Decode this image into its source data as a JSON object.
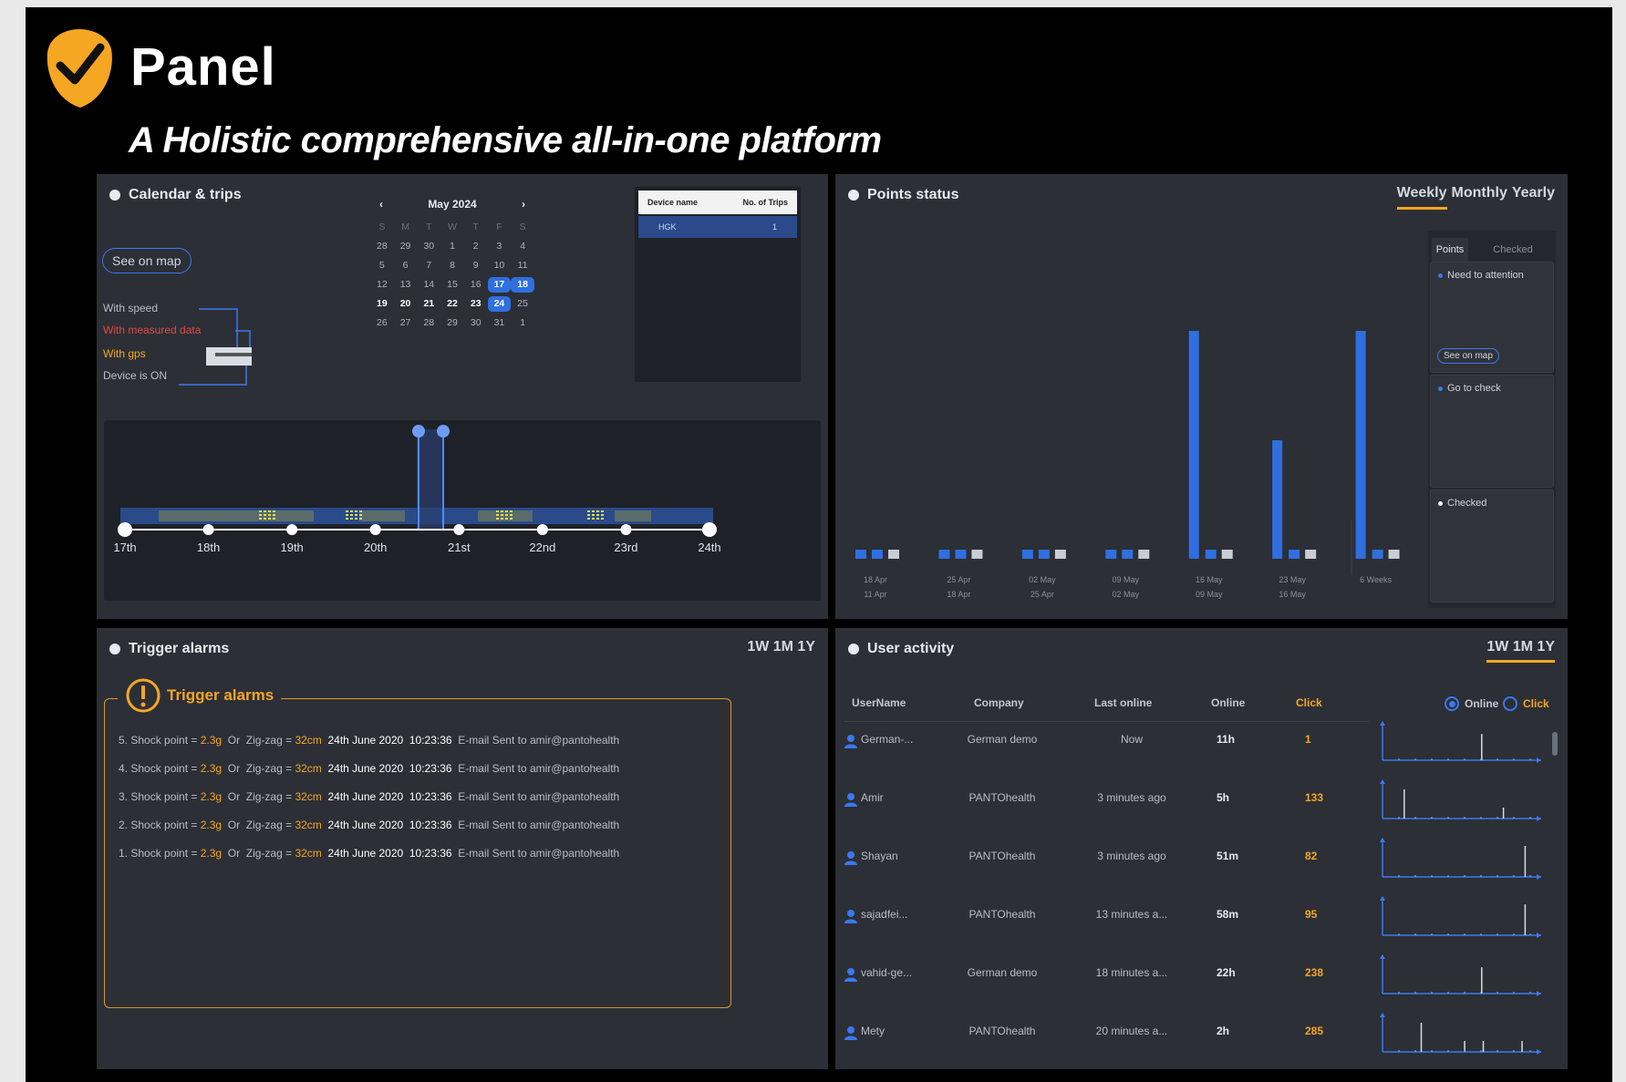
{
  "brand": {
    "name": "Panel",
    "tagline": "A Holistic comprehensive all-in-one platform"
  },
  "colors": {
    "accent_blue": "#3b78f0",
    "accent_orange": "#f5a623",
    "panel_bg": "#2c2f36"
  },
  "calendar_panel": {
    "title": "Calendar & trips",
    "see_on_map": "See on map",
    "month_label": "May 2024",
    "weekdays": [
      "S",
      "M",
      "T",
      "W",
      "T",
      "F",
      "S"
    ],
    "weeks": [
      [
        "28",
        "29",
        "30",
        "1",
        "2",
        "3",
        "4"
      ],
      [
        "5",
        "6",
        "7",
        "8",
        "9",
        "10",
        "11"
      ],
      [
        "12",
        "13",
        "14",
        "15",
        "16",
        "17",
        "18"
      ],
      [
        "19",
        "20",
        "21",
        "22",
        "23",
        "24",
        "25"
      ],
      [
        "26",
        "27",
        "28",
        "29",
        "30",
        "31",
        "1"
      ]
    ],
    "legend": {
      "speed": "With speed",
      "measured": "With measured data",
      "gps": "With gps",
      "device": "Device is ON"
    },
    "device_table": {
      "col_name": "Device name",
      "col_trips": "No. of Trips",
      "rows": [
        {
          "name": "HGK",
          "trips": "1"
        }
      ]
    },
    "timeline_days": [
      "17th",
      "18th",
      "19th",
      "20th",
      "21st",
      "22nd",
      "23rd",
      "24th"
    ]
  },
  "points_panel": {
    "title": "Points status",
    "periods": [
      "Weekly",
      "Monthly",
      "Yearly"
    ],
    "active_period": "Weekly",
    "side_tabs": [
      "Points",
      "Checked"
    ],
    "cards": {
      "attention": "Need to attention",
      "see_on_map": "See on map",
      "go_check": "Go to check",
      "checked": "Checked"
    },
    "x_labels_top": [
      "18 Apr",
      "25 Apr",
      "02 May",
      "09 May",
      "16 May",
      "23 May",
      "6 Weeks"
    ],
    "x_labels_bottom": [
      "11 Apr",
      "18 Apr",
      "25 Apr",
      "02 May",
      "09 May",
      "16 May",
      ""
    ]
  },
  "chart_data": {
    "type": "bar",
    "categories": [
      "11 Apr - 18 Apr",
      "18 Apr - 25 Apr",
      "25 Apr - 02 May",
      "02 May - 09 May",
      "09 May - 16 May",
      "16 May - 23 May",
      "6 Weeks"
    ],
    "series": [
      {
        "values": [
          0.04,
          0.04,
          0.04,
          0.04,
          1.0,
          0.52,
          1.0
        ]
      },
      {
        "values": [
          0.04,
          0.04,
          0.04,
          0.04,
          0.04,
          0.04,
          0.04
        ]
      },
      {
        "values": [
          0.04,
          0.04,
          0.04,
          0.04,
          0.04,
          0.04,
          0.04
        ]
      }
    ],
    "colors": [
      "#2f6fe0",
      "#2f6fe0",
      "#c8ccd3"
    ]
  },
  "alarms_panel": {
    "title": "Trigger alarms",
    "periods": "1W 1M 1Y",
    "box_title": "Trigger alarms",
    "items": [
      {
        "idx": "5. Shock point = ",
        "g": "2.3g",
        "or": "  Or  Zig-zag = ",
        "cm": "32cm",
        "date": "  24th June 2020  10:23:36",
        "mail": "  E-mail Sent to amir@pantohealth"
      },
      {
        "idx": "4. Shock point = ",
        "g": "2.3g",
        "or": "  Or  Zig-zag = ",
        "cm": "32cm",
        "date": "  24th June 2020  10:23:36",
        "mail": "  E-mail Sent to amir@pantohealth"
      },
      {
        "idx": "3. Shock point = ",
        "g": "2.3g",
        "or": "  Or  Zig-zag = ",
        "cm": "32cm",
        "date": "  24th June 2020  10:23:36",
        "mail": "  E-mail Sent to amir@pantohealth"
      },
      {
        "idx": "2. Shock point = ",
        "g": "2.3g",
        "or": "  Or  Zig-zag = ",
        "cm": "32cm",
        "date": "  24th June 2020  10:23:36",
        "mail": "  E-mail Sent to amir@pantohealth"
      },
      {
        "idx": "1. Shock point = ",
        "g": "2.3g",
        "or": "  Or  Zig-zag = ",
        "cm": "32cm",
        "date": "  24th June 2020  10:23:36",
        "mail": "  E-mail Sent to amir@pantohealth"
      }
    ]
  },
  "user_panel": {
    "title": "User activity",
    "periods": "1W 1M 1Y",
    "headers": {
      "user": "UserName",
      "company": "Company",
      "last": "Last online",
      "online": "Online",
      "click": "Click"
    },
    "radio_online": "Online",
    "radio_click": "Click",
    "rows": [
      {
        "name": "German-...",
        "company": "German demo",
        "last": "Now",
        "online": "11h",
        "click": "1",
        "spikes": [
          0.65
        ]
      },
      {
        "name": "Amir",
        "company": "PANTOhealth",
        "last": "3 minutes ago",
        "online": "5h",
        "click": "133",
        "spikes": [
          0.2,
          0.6
        ]
      },
      {
        "name": "Shayan",
        "company": "PANTOhealth",
        "last": "3 minutes ago",
        "online": "51m",
        "click": "82",
        "spikes": [
          0.9
        ]
      },
      {
        "name": "sajadfei...",
        "company": "PANTOhealth",
        "last": "13 minutes a...",
        "online": "58m",
        "click": "95",
        "spikes": [
          0.9
        ]
      },
      {
        "name": "vahid-ge...",
        "company": "German demo",
        "last": "18 minutes a...",
        "online": "22h",
        "click": "238",
        "spikes": [
          0.65
        ]
      },
      {
        "name": "Mety",
        "company": "PANTOhealth",
        "last": "20 minutes a...",
        "online": "2h",
        "click": "285",
        "spikes": [
          0.25,
          0.5,
          0.65,
          0.9
        ]
      }
    ]
  }
}
